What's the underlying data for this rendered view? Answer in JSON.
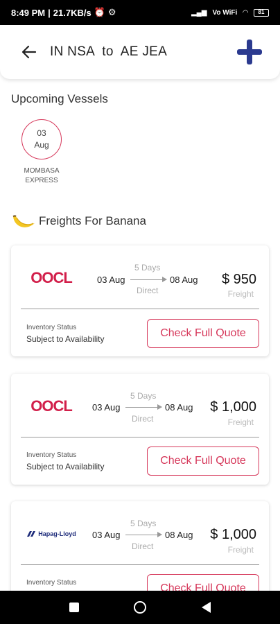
{
  "status_bar": {
    "time": "8:49 PM",
    "speed": "21.7KB/s",
    "network": "Vo WiFi",
    "battery": "81"
  },
  "header": {
    "route": "IN NSA  to  AE JEA"
  },
  "vessels": {
    "title": "Upcoming Vessels",
    "items": [
      {
        "day": "03",
        "month": "Aug",
        "name_line1": "MOMBASA",
        "name_line2": "EXPRESS"
      }
    ]
  },
  "freights": {
    "title": "Freights For Banana",
    "cards": [
      {
        "carrier": "OOCL",
        "from": "03 Aug",
        "days": "5  Days",
        "direct": "Direct",
        "to": "08 Aug",
        "price": "$ 950",
        "price_label": "Freight",
        "inv_label": "Inventory Status",
        "inv_value": "Subject to Availability",
        "button": "Check Full Quote"
      },
      {
        "carrier": "OOCL",
        "from": "03 Aug",
        "days": "5  Days",
        "direct": "Direct",
        "to": "08 Aug",
        "price": "$ 1,000",
        "price_label": "Freight",
        "inv_label": "Inventory Status",
        "inv_value": "Subject to Availability",
        "button": "Check Full Quote"
      },
      {
        "carrier": "Hapag-Lloyd",
        "from": "03 Aug",
        "days": "5  Days",
        "direct": "Direct",
        "to": "08 Aug",
        "price": "$ 1,000",
        "price_label": "Freight",
        "inv_label": "Inventory Status",
        "inv_value": "",
        "button": "Check Full Quote"
      }
    ]
  },
  "colors": {
    "accent": "#d6375a",
    "add_button": "#2b3a8f",
    "oocl_red": "#d21f4a",
    "hapag_blue": "#1d2b7a"
  }
}
